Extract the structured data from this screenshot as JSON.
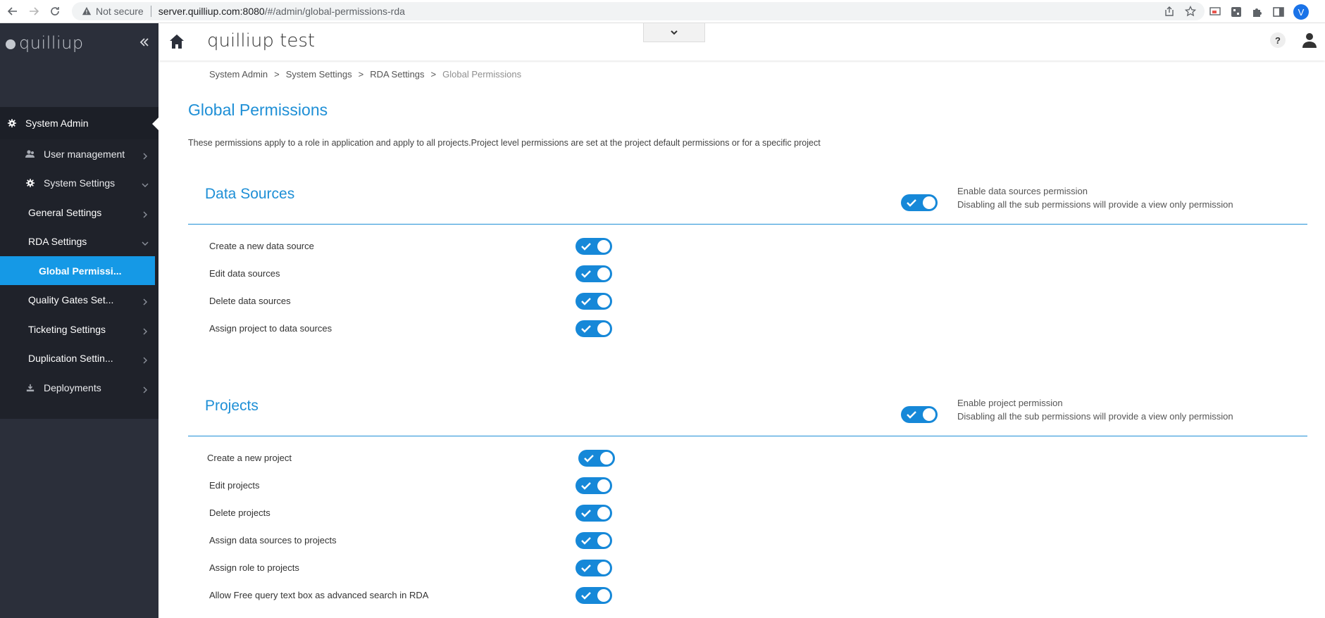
{
  "browser": {
    "not_secure": "Not secure",
    "url_host": "server.quilliup.com:8080",
    "url_path": "/#/admin/global-permissions-rda",
    "profile_initial": "V"
  },
  "sidebar": {
    "logo": "quilliup",
    "system_admin": "System Admin",
    "items": [
      {
        "label": "User management"
      },
      {
        "label": "System Settings"
      },
      {
        "label": "General Settings"
      },
      {
        "label": "RDA Settings"
      },
      {
        "label": "Global Permissi..."
      },
      {
        "label": "Quality Gates Set..."
      },
      {
        "label": "Ticketing Settings"
      },
      {
        "label": "Duplication Settin..."
      },
      {
        "label": "Deployments"
      }
    ]
  },
  "header": {
    "title": "quilliup test",
    "help": "?"
  },
  "breadcrumb": {
    "items": [
      "System Admin",
      ">",
      "System Settings",
      ">",
      "RDA Settings",
      ">",
      "Global Permissions"
    ]
  },
  "page": {
    "title": "Global Permissions",
    "description": "These permissions apply to a role in application and apply to all projects.Project level permissions are set at the project default permissions or for a specific project"
  },
  "sections": [
    {
      "title": "Data Sources",
      "enable_label": "Enable data sources permission",
      "enable_note": "Disabling all the sub permissions will provide a view only permission",
      "enabled": true,
      "permissions": [
        {
          "label": "Create a new data source",
          "enabled": true
        },
        {
          "label": "Edit data sources",
          "enabled": true
        },
        {
          "label": "Delete data sources",
          "enabled": true
        },
        {
          "label": "Assign project to data sources",
          "enabled": true
        }
      ]
    },
    {
      "title": "Projects",
      "enable_label": "Enable project permission",
      "enable_note": "Disabling all the sub permissions will provide a view only permission",
      "enabled": true,
      "permissions": [
        {
          "label": "Create a new project",
          "enabled": true
        },
        {
          "label": "Edit projects",
          "enabled": true
        },
        {
          "label": "Delete projects",
          "enabled": true
        },
        {
          "label": "Assign data sources to projects",
          "enabled": true
        },
        {
          "label": "Assign role to projects",
          "enabled": true
        },
        {
          "label": "Allow Free query text box as advanced search in RDA",
          "enabled": true
        }
      ]
    }
  ],
  "colors": {
    "accent": "#1e8fd6",
    "toggle_on": "#1688d8",
    "sidebar_bg": "#2b2f3a",
    "active_item": "#1599e6"
  }
}
